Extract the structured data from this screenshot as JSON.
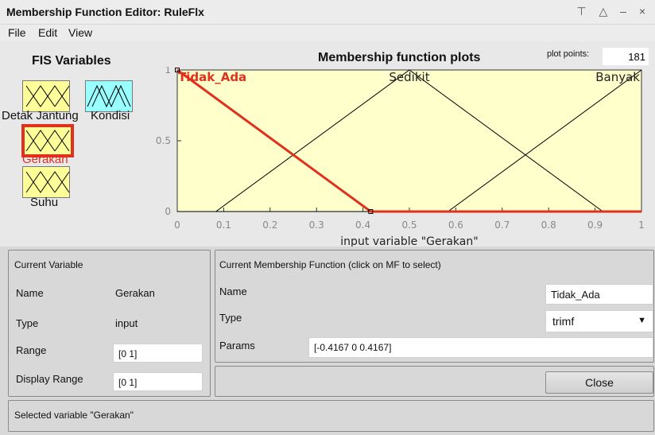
{
  "window": {
    "title": "Membership Function Editor: RuleFlx",
    "controls": "⊤ △ – ×"
  },
  "menu": {
    "items": [
      "File",
      "Edit",
      "View"
    ]
  },
  "fis": {
    "heading": "FIS Variables",
    "variables": [
      {
        "label": "Detak Jantung",
        "color": "#ffff99"
      },
      {
        "label": "Kondisi",
        "color": "#99ffff"
      },
      {
        "label": "Gerakan",
        "color": "#ffff99",
        "selected": true
      },
      {
        "label": "Suhu",
        "color": "#ffff99"
      }
    ],
    "selected_color": "#e0301e"
  },
  "plot": {
    "title": "Membership function plots",
    "points_label": "plot points:",
    "points_value": "181",
    "xlabel": "input variable \"Gerakan\""
  },
  "chart_data": {
    "type": "line",
    "title": "Membership function plots",
    "xlabel": "input variable \"Gerakan\"",
    "xlim": [
      0,
      1
    ],
    "ylim": [
      0,
      1
    ],
    "xticks": [
      "0",
      "0.1",
      "0.2",
      "0.3",
      "0.4",
      "0.5",
      "0.6",
      "0.7",
      "0.8",
      "0.9",
      "1"
    ],
    "yticks": [
      "0",
      "0.5",
      "1"
    ],
    "background": "#ffffcc",
    "series": [
      {
        "name": "Tidak_Ada",
        "points": [
          [
            0,
            1
          ],
          [
            0.4167,
            0
          ],
          [
            1,
            0
          ]
        ],
        "color": "#e0301e",
        "selected": true
      },
      {
        "name": "Sedikit",
        "points": [
          [
            0,
            0
          ],
          [
            0.0833,
            0
          ],
          [
            0.5,
            1
          ],
          [
            0.9167,
            0
          ],
          [
            1,
            0
          ]
        ],
        "color": "#000000"
      },
      {
        "name": "Banyak",
        "points": [
          [
            0,
            0
          ],
          [
            0.5833,
            0
          ],
          [
            1,
            1
          ]
        ],
        "color": "#000000"
      }
    ]
  },
  "current_variable": {
    "heading": "Current Variable",
    "name_label": "Name",
    "name_value": "Gerakan",
    "type_label": "Type",
    "type_value": "input",
    "range_label": "Range",
    "range_value": "[0 1]",
    "display_range_label": "Display Range",
    "display_range_value": "[0 1]"
  },
  "current_mf": {
    "heading": "Current Membership Function (click on MF to select)",
    "name_label": "Name",
    "name_value": "Tidak_Ada",
    "type_label": "Type",
    "type_value": "trimf",
    "params_label": "Params",
    "params_value": "[-0.4167 0 0.4167]"
  },
  "buttons": {
    "close": "Close"
  },
  "status": {
    "text": "Selected variable \"Gerakan\""
  }
}
